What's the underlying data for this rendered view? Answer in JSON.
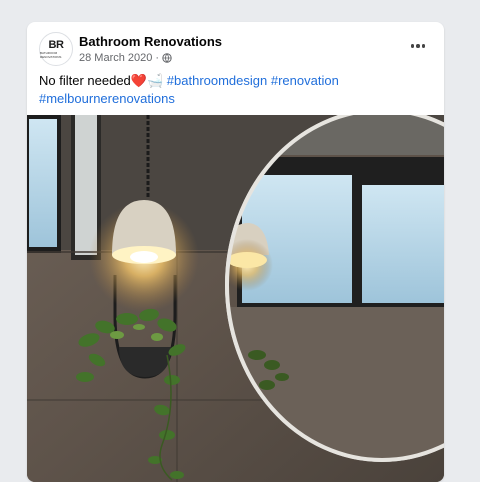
{
  "post": {
    "page_name": "Bathroom Renovations",
    "date": "28 March 2020",
    "separator": "·",
    "avatar_mono": "BR",
    "avatar_sub": "BATHROOM RENOVATIONS",
    "caption_text": "No filter needed",
    "caption_emoji_heart": "❤️",
    "caption_emoji_bath": "🛁",
    "hashtags": [
      "#bathroomdesign",
      "#renovation",
      "#melbournerenovations"
    ]
  },
  "icons": {
    "privacy": "globe-icon",
    "menu": "more-options-icon"
  },
  "colors": {
    "hashtag": "#216fdb",
    "page_background": "#e9ebee",
    "secondary_text": "#65676b"
  }
}
